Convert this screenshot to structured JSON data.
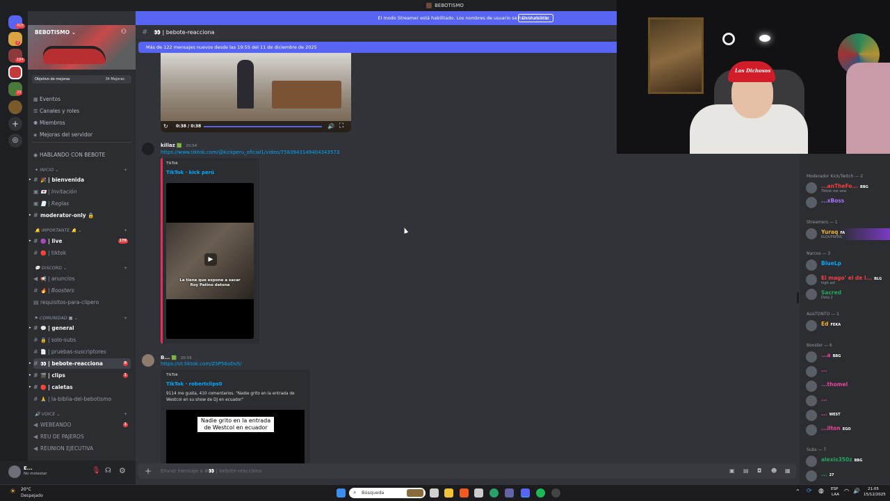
{
  "window": {
    "title": "BEBOTISMO"
  },
  "streamer_bar": {
    "message": "El modo Streamer está habilitado. Los nombres de usuario se han truncado.",
    "button": "Deshabilitar"
  },
  "servers": {
    "badges": [
      "410",
      "2",
      "184",
      "23"
    ]
  },
  "sidebar": {
    "server_name": "BEBOTISMO",
    "goal_label": "Objetivo de mejoras",
    "goal_count": "34 Mejoras",
    "nav": [
      "Eventos",
      "Canales y roles",
      "Miembros",
      "Mejoras del servidor"
    ],
    "section_top": "HABLANDO CON BEBOTE",
    "categories": [
      "INICIO",
      "IMPORTANTE",
      "DISCORD",
      "COMUNIDAD",
      "VOICE"
    ],
    "channels": {
      "bienvenida": "bienvenida",
      "invitacion": "Invitación",
      "reglas": "Reglas",
      "moderator_only": "moderator-only",
      "live": "live",
      "live_badge": "178",
      "tiktok": "tiktok",
      "anuncios": "anuncios",
      "boosters": "Boosters",
      "requisitos": "requisitos-para-clipero",
      "general": "general",
      "solo_subs": "solo-subs",
      "pruebas": "pruebas-suscriptores",
      "bebote_reacciona": "bebote-reacciona",
      "bebote_badge": "9",
      "clips": "clips",
      "clips_badge": "1",
      "caletas": "caletas",
      "biblia": "la-biblia-del-bebotismo",
      "webeando": "WEBEANDO",
      "webeando_badge": "1",
      "reu": "REU DE PAJEROS",
      "reunion": "REUNION EJECUTIVA"
    }
  },
  "user_panel": {
    "name": "E...",
    "status": "No molestar"
  },
  "chat": {
    "channel": "bebote-reacciona",
    "new_messages": "Más de 122 mensajes nuevos desde las 19:55 del 11 de diciembre de 2025",
    "video_time": "0:38 / 0:38",
    "messages": [
      {
        "author": "killaz",
        "time": "20:54",
        "link": "https://www.tiktok.com/@kickperu_oficial1/video/7583943149404343573",
        "provider": "TikTok",
        "title": "TikTok · kick perú",
        "caption": "La tiene que expone a sacar Roy Patino detona"
      },
      {
        "author": "B...",
        "time": "20:55",
        "link": "https://vt.tiktok.com/ZSP56aDvS/",
        "provider": "TikTok",
        "title": "TikTok · robertclips0",
        "description": "9114 me gusta, 410 comentarios. \"Nadie grito en la entrada de Westcol en su show de DJ en ecuador\"",
        "video_text": "Nadie grito en la entrada de Westcol en ecuador"
      }
    ],
    "composer_placeholder": "Enviar mensaje a #👀 | bebote-reacciona"
  },
  "webcam": {
    "cap_text": "Los Dichosos"
  },
  "members": {
    "groups": [
      {
        "label": "Moderador Kick/Twitch — 2",
        "people": [
          {
            "name": "...anTheFo...",
            "tag": "BBG",
            "sub": "Tiktok me vew",
            "color": "#f23f43"
          },
          {
            "name": "...xBoss",
            "tag": "",
            "sub": "",
            "color": "#a672ff"
          }
        ]
      },
      {
        "label": "Streamers — 1",
        "people": [
          {
            "name": "Yuraq",
            "tag": "FA",
            "sub": "KLOUFRENS",
            "color": "#f0b132"
          }
        ]
      },
      {
        "label": "Narcos — 3",
        "people": [
          {
            "name": "BlueLp",
            "tag": "",
            "sub": "",
            "color": "#00a8fc"
          },
          {
            "name": "El mago' el de l...",
            "tag": "BLG",
            "sub": "high asf",
            "color": "#f23f43"
          },
          {
            "name": "Sacred",
            "tag": "",
            "sub": "Dota 2",
            "color": "#23a55a"
          }
        ]
      },
      {
        "label": "AsisTONTO — 1",
        "people": [
          {
            "name": "Ed",
            "tag": "FEKA",
            "sub": "",
            "color": "#f0b132"
          }
        ]
      },
      {
        "label": "Booster — 6",
        "people": [
          {
            "name": "...a",
            "tag": "BBG",
            "sub": "",
            "color": "#eb459e"
          },
          {
            "name": "...",
            "tag": "",
            "sub": "",
            "color": "#eb459e"
          },
          {
            "name": "...thomel",
            "tag": "",
            "sub": "",
            "color": "#eb459e"
          },
          {
            "name": "...",
            "tag": "",
            "sub": "",
            "color": "#eb459e"
          },
          {
            "name": "...",
            "tag": "WEST",
            "sub": "",
            "color": "#eb459e"
          },
          {
            "name": "...ilton",
            "tag": "EGO",
            "sub": "",
            "color": "#eb459e"
          }
        ]
      },
      {
        "label": "Subs — 7",
        "people": [
          {
            "name": "alexis350z",
            "tag": "BBG",
            "sub": "",
            "color": "#23a55a"
          },
          {
            "name": "...",
            "tag": "27",
            "sub": "",
            "color": "#23a55a"
          }
        ]
      }
    ]
  },
  "taskbar": {
    "weather_temp": "20°C",
    "weather_desc": "Despejado",
    "search": "Búsqueda",
    "lang": "ESP",
    "lang2": "LAA",
    "time": "21:05",
    "date": "15/12/2025"
  }
}
